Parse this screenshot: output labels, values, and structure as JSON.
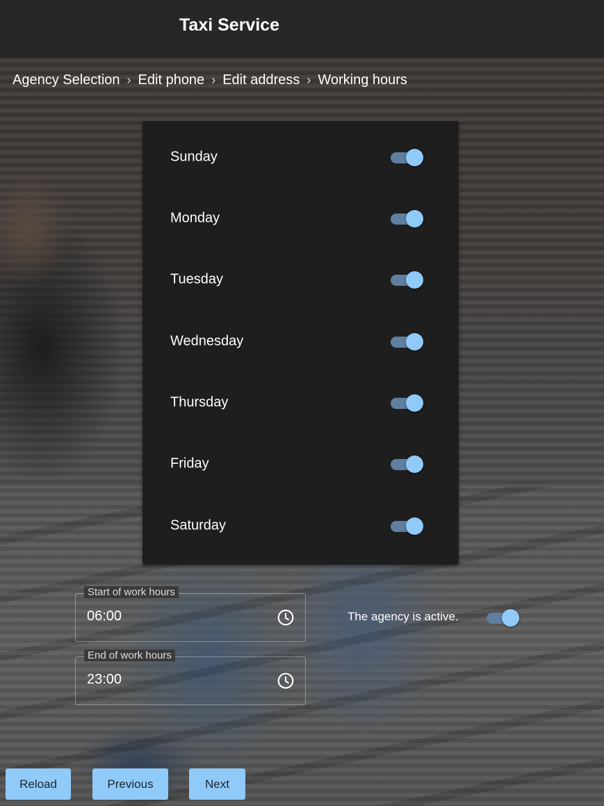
{
  "app": {
    "title": "Taxi Service"
  },
  "breadcrumb": {
    "items": [
      "Agency Selection",
      "Edit phone",
      "Edit address",
      "Working hours"
    ],
    "separator": "›"
  },
  "days": [
    {
      "label": "Sunday",
      "enabled": true
    },
    {
      "label": "Monday",
      "enabled": true
    },
    {
      "label": "Tuesday",
      "enabled": true
    },
    {
      "label": "Wednesday",
      "enabled": true
    },
    {
      "label": "Thursday",
      "enabled": true
    },
    {
      "label": "Friday",
      "enabled": true
    },
    {
      "label": "Saturday",
      "enabled": true
    }
  ],
  "hours": {
    "start": {
      "label": "Start of work hours",
      "value": "06:00",
      "icon": "clock-icon"
    },
    "end": {
      "label": "End of work hours",
      "value": "23:00",
      "icon": "clock-icon"
    }
  },
  "agency_active": {
    "label": "The agency is active.",
    "enabled": true
  },
  "buttons": {
    "reload": "Reload",
    "previous": "Previous",
    "next": "Next"
  },
  "colors": {
    "accent": "#90caf9",
    "toggle_track": "#5f7fa0",
    "card": "#1e1e1e",
    "topbar": "#272727"
  }
}
